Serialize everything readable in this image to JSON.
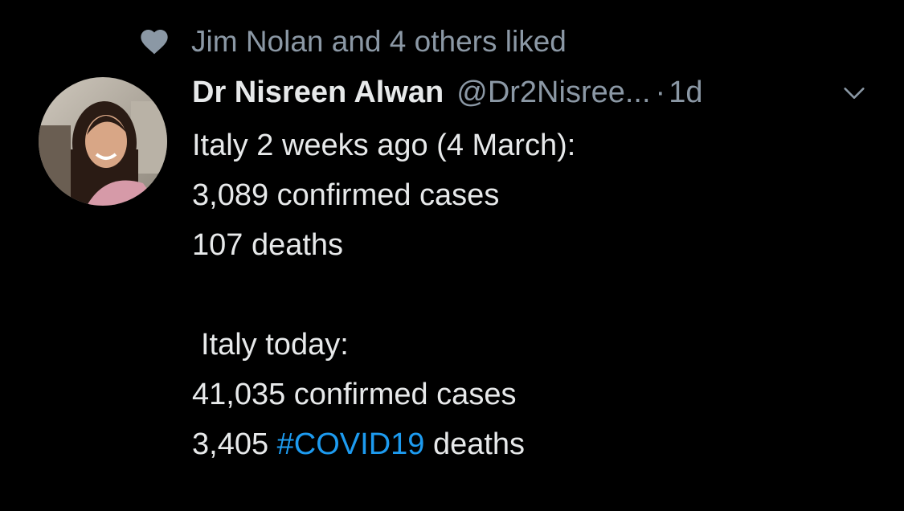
{
  "social_context": {
    "text": "Jim Nolan and 4 others liked",
    "icon": "heart-icon"
  },
  "author": {
    "display_name": "Dr Nisreen Alwan",
    "handle": "@Dr2Nisree...",
    "separator": "·",
    "timestamp": "1d"
  },
  "tweet": {
    "lines": [
      "Italy 2 weeks ago (4 March):",
      "3,089 confirmed cases",
      "107 deaths",
      "",
      "Italy today:",
      "41,035 confirmed cases"
    ],
    "last_line_prefix": "3,405",
    "hashtag": "#COVID19",
    "last_line_suffix": "deaths"
  },
  "colors": {
    "background": "#000000",
    "primary_text": "#e7e9ea",
    "secondary_text": "#8b98a5",
    "link": "#1d9bf0"
  }
}
